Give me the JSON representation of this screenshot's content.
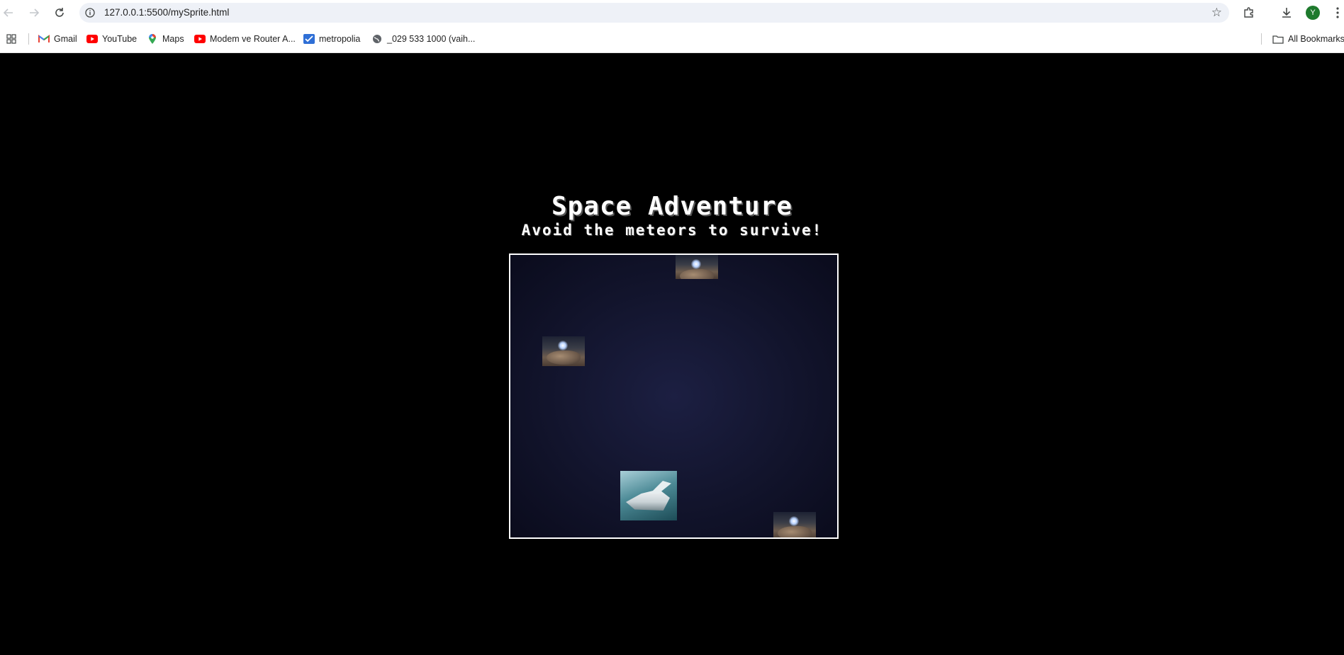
{
  "browser": {
    "url": "127.0.0.1:5500/mySprite.html",
    "profile_initial": "Y",
    "accent_color": "#1e7a2d",
    "bookmarks": [
      {
        "label": "Gmail",
        "icon": "gmail-icon"
      },
      {
        "label": "YouTube",
        "icon": "youtube-icon"
      },
      {
        "label": "Maps",
        "icon": "maps-icon"
      },
      {
        "label": "Modem ve Router A...",
        "icon": "youtube-icon"
      },
      {
        "label": "metropolia",
        "icon": "mail-check-icon"
      },
      {
        "label": "_029 533 1000 (vaih...",
        "icon": "globe-icon"
      }
    ],
    "all_bookmarks_label": "All Bookmarks"
  },
  "game": {
    "title": "Space Adventure",
    "subtitle": "Avoid the meteors to survive!",
    "sprites": [
      "meteor",
      "meteor",
      "meteor",
      "spaceship"
    ]
  }
}
